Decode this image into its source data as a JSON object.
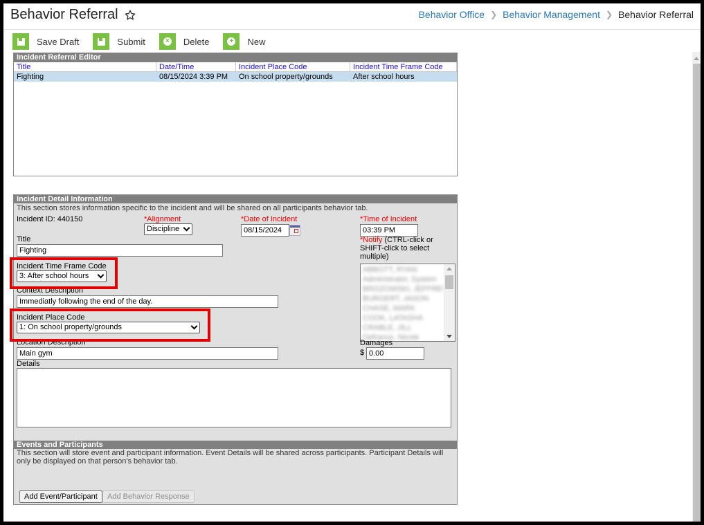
{
  "header": {
    "title": "Behavior Referral",
    "breadcrumb": [
      {
        "label": "Behavior Office",
        "link": true
      },
      {
        "label": "Behavior Management",
        "link": true
      },
      {
        "label": "Behavior Referral",
        "link": false
      }
    ]
  },
  "toolbar": {
    "save_draft": "Save Draft",
    "submit": "Submit",
    "delete": "Delete",
    "new": "New"
  },
  "editor": {
    "header": "Incident Referral Editor",
    "columns": [
      "Title",
      "Date/Time",
      "Incident Place Code",
      "Incident Time Frame Code"
    ],
    "rows": [
      [
        "Fighting",
        "08/15/2024 3:39 PM",
        "On school property/grounds",
        "After school hours"
      ]
    ]
  },
  "detail": {
    "header": "Incident Detail Information",
    "description": "This section stores information specific to the incident and will be shared on all participants behavior tab.",
    "incident_id_label": "Incident ID: 440150",
    "alignment_label": "*Alignment",
    "alignment_value": "Discipline",
    "date_label": "*Date of Incident",
    "date_value": "08/15/2024",
    "time_label": "*Time of Incident",
    "time_value": "03:39 PM",
    "title_label": "Title",
    "title_value": "Fighting",
    "notify_label_req": "*Notify",
    "notify_label_rest": " (CTRL-click or SHIFT-click to select multiple)",
    "notify_items": [
      "ABBOTT, RYAN",
      "Administrator, System",
      "BROZOWSKI, JEFFREY",
      "BURGERT, JASON",
      "CHASE, MARK",
      "COOK, LATASHA",
      "CRABLE, JILL",
      "Defrance, Nicole"
    ],
    "time_frame_label": "Incident Time Frame Code",
    "time_frame_value": "3: After school hours",
    "context_label": "Context Description",
    "context_value": "Immediatly following the end of the day.",
    "place_label": "Incident Place Code",
    "place_value": "1: On school property/grounds",
    "location_label": "Location Description",
    "location_value": "Main gym",
    "damages_label": "Damages",
    "damages_currency": "$",
    "damages_value": "0.00",
    "details_label": "Details",
    "details_value": ""
  },
  "events": {
    "header": "Events and Participants",
    "description": "This section will store event and participant information. Event Details will be shared across participants. Participant Details will only be displayed on that person's behavior tab.",
    "add_event_button": "Add Event/Participant",
    "add_response_button": "Add Behavior Response"
  },
  "colors": {
    "accent_green": "#7ac143",
    "link_blue": "#2a78b6",
    "required_red": "#ee0000",
    "highlight_box": "#e00000",
    "selected_row": "#c6dcef"
  }
}
